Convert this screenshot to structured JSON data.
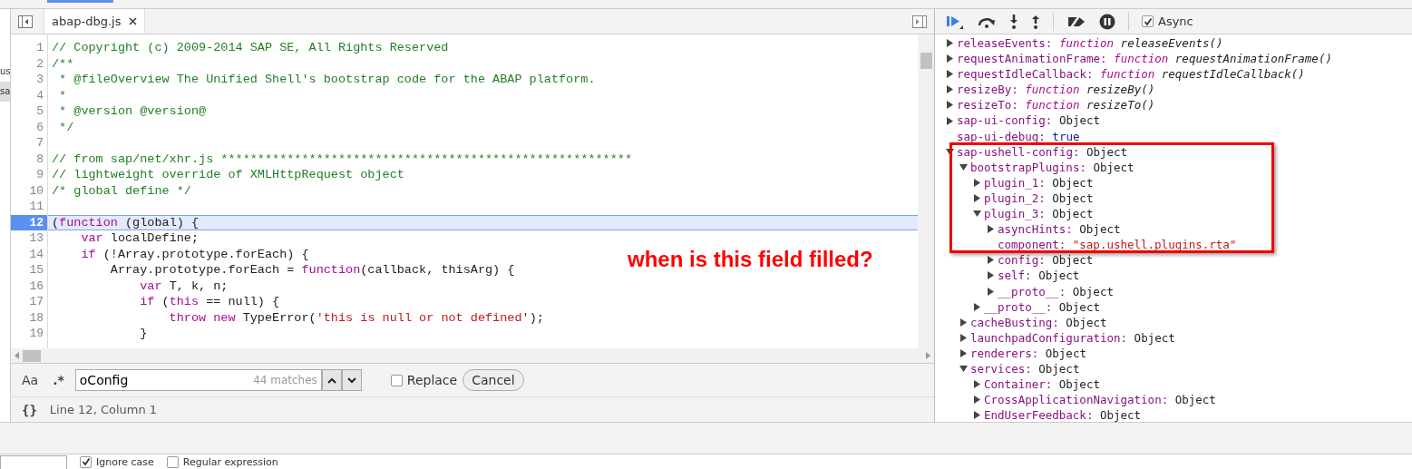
{
  "left_panel": {
    "items": [
      {
        "label": "us",
        "selected": false
      },
      {
        "label": "sa",
        "selected": true
      }
    ]
  },
  "editor": {
    "tabs": [
      {
        "label": "abap-dbg.js",
        "selected": true,
        "closable": true
      }
    ],
    "lines": [
      {
        "number": "1",
        "current": false,
        "tokens": [
          {
            "kind": "comment",
            "t": "// Copyright (c) 2009-2014 SAP SE, All Rights Reserved"
          }
        ]
      },
      {
        "number": "2",
        "current": false,
        "tokens": [
          {
            "kind": "comment",
            "t": "/**"
          }
        ]
      },
      {
        "number": "3",
        "current": false,
        "tokens": [
          {
            "kind": "comment",
            "t": " * @fileOverview The Unified Shell's bootstrap code for the ABAP platform."
          }
        ]
      },
      {
        "number": "4",
        "current": false,
        "tokens": [
          {
            "kind": "comment",
            "t": " *"
          }
        ]
      },
      {
        "number": "5",
        "current": false,
        "tokens": [
          {
            "kind": "comment",
            "t": " * @version @version@"
          }
        ]
      },
      {
        "number": "6",
        "current": false,
        "tokens": [
          {
            "kind": "comment",
            "t": " */"
          }
        ]
      },
      {
        "number": "7",
        "current": false
      },
      {
        "number": "8",
        "current": false,
        "tokens": [
          {
            "kind": "comment",
            "t": "// from sap/net/xhr.js ********************************************************"
          }
        ]
      },
      {
        "number": "9",
        "current": false,
        "tokens": [
          {
            "kind": "comment",
            "t": "// lightweight override of XMLHttpRequest object"
          }
        ]
      },
      {
        "number": "10",
        "current": false,
        "tokens": [
          {
            "kind": "comment",
            "t": "/* global define */"
          }
        ]
      },
      {
        "number": "11",
        "current": false
      },
      {
        "number": "12",
        "current": true,
        "tokens": [
          {
            "kind": "plain",
            "t": "("
          },
          {
            "kind": "keyword",
            "t": "function"
          },
          {
            "kind": "plain",
            "t": " (global) {"
          }
        ]
      },
      {
        "number": "13",
        "current": false,
        "tokens": [
          {
            "kind": "keyword",
            "t": "    var"
          },
          {
            "kind": "plain",
            "t": " localDefine;"
          }
        ]
      },
      {
        "number": "14",
        "current": false,
        "tokens": [
          {
            "kind": "keyword",
            "t": "    if"
          },
          {
            "kind": "plain",
            "t": " (!Array.prototype.forEach) {"
          }
        ]
      },
      {
        "number": "15",
        "current": false,
        "tokens": [
          {
            "kind": "plain",
            "t": "        Array.prototype.forEach = "
          },
          {
            "kind": "keyword",
            "t": "function"
          },
          {
            "kind": "plain",
            "t": "(callback, thisArg) {"
          }
        ]
      },
      {
        "number": "16",
        "current": false,
        "tokens": [
          {
            "kind": "keyword",
            "t": "            var"
          },
          {
            "kind": "plain",
            "t": " T, k, n;"
          }
        ]
      },
      {
        "number": "17",
        "current": false,
        "tokens": [
          {
            "kind": "keyword",
            "t": "            if"
          },
          {
            "kind": "plain",
            "t": " ("
          },
          {
            "kind": "keyword",
            "t": "this"
          },
          {
            "kind": "plain",
            "t": " == null) {"
          }
        ]
      },
      {
        "number": "18",
        "current": false,
        "tokens": [
          {
            "kind": "keyword",
            "t": "                throw new"
          },
          {
            "kind": "plain",
            "t": " TypeError("
          },
          {
            "kind": "string",
            "t": "'this is null or not defined'"
          },
          {
            "kind": "plain",
            "t": ");"
          }
        ]
      },
      {
        "number": "19",
        "current": false,
        "tokens": [
          {
            "kind": "plain",
            "t": "            }"
          }
        ]
      }
    ]
  },
  "search": {
    "case_label": "Aa",
    "regex_label": ".*",
    "query": "oConfig",
    "matches": "44 matches",
    "replace": {
      "label": "Replace",
      "checked": false
    },
    "cancel": "Cancel"
  },
  "status": {
    "format_label": "{}",
    "position": "Line 12, Column 1"
  },
  "annotation": {
    "text": "when is this field filled?"
  },
  "debugger": {
    "async": {
      "label": "Async",
      "checked": true
    },
    "tree": [
      {
        "key": "releaseEvents:",
        "kind": "function",
        "keyword": "function",
        "value": "releaseEvents()",
        "expanded": false
      },
      {
        "key": "requestAnimationFrame:",
        "kind": "function",
        "keyword": "function",
        "value": "requestAnimationFrame()",
        "expanded": false
      },
      {
        "key": "requestIdleCallback:",
        "kind": "function",
        "keyword": "function",
        "value": "requestIdleCallback()",
        "expanded": false
      },
      {
        "key": "resizeBy:",
        "kind": "function",
        "keyword": "function",
        "value": "resizeBy()",
        "expanded": false
      },
      {
        "key": "resizeTo:",
        "kind": "function",
        "keyword": "function",
        "value": "resizeTo()",
        "expanded": false
      },
      {
        "key": "sap-ui-config:",
        "kind": "object",
        "value": "Object",
        "expanded": false
      },
      {
        "key": "sap-ui-debug:",
        "kind": "boolean",
        "value": "true"
      },
      {
        "key": "sap-ushell-config:",
        "kind": "object",
        "value": "Object",
        "expanded": true,
        "children": [
          {
            "key": "bootstrapPlugins:",
            "kind": "object",
            "value": "Object",
            "expanded": true,
            "children": [
              {
                "key": "plugin_1:",
                "kind": "object",
                "value": "Object",
                "expanded": false
              },
              {
                "key": "plugin_2:",
                "kind": "object",
                "value": "Object",
                "expanded": false
              },
              {
                "key": "plugin_3:",
                "kind": "object",
                "value": "Object",
                "expanded": true,
                "children": [
                  {
                    "key": "asyncHints:",
                    "kind": "object",
                    "value": "Object",
                    "expanded": false
                  },
                  {
                    "key": "component:",
                    "kind": "string",
                    "value": "\"sap.ushell.plugins.rta\""
                  },
                  {
                    "key": "config:",
                    "kind": "object",
                    "value": "Object",
                    "expanded": false
                  },
                  {
                    "key": "self:",
                    "kind": "object",
                    "value": "Object",
                    "expanded": false
                  },
                  {
                    "key": "__proto__:",
                    "kind": "object",
                    "value": "Object",
                    "expanded": false
                  }
                ]
              },
              {
                "key": "__proto__:",
                "kind": "object",
                "value": "Object",
                "expanded": false
              }
            ]
          },
          {
            "key": "cacheBusting:",
            "kind": "object",
            "value": "Object",
            "expanded": false
          },
          {
            "key": "launchpadConfiguration:",
            "kind": "object",
            "value": "Object",
            "expanded": false
          },
          {
            "key": "renderers:",
            "kind": "object",
            "value": "Object",
            "expanded": false
          },
          {
            "key": "services:",
            "kind": "object",
            "value": "Object",
            "expanded": true,
            "children": [
              {
                "key": "Container:",
                "kind": "object",
                "value": "Object",
                "expanded": false
              },
              {
                "key": "CrossApplicationNavigation:",
                "kind": "object",
                "value": "Object",
                "expanded": false
              },
              {
                "key": "EndUserFeedback:",
                "kind": "object",
                "value": "Object",
                "expanded": false
              }
            ]
          }
        ]
      }
    ]
  },
  "bottom_bar": {
    "options": [
      {
        "label": "Ignore case",
        "checked": true
      },
      {
        "label": "Regular expression",
        "checked": false
      }
    ]
  }
}
